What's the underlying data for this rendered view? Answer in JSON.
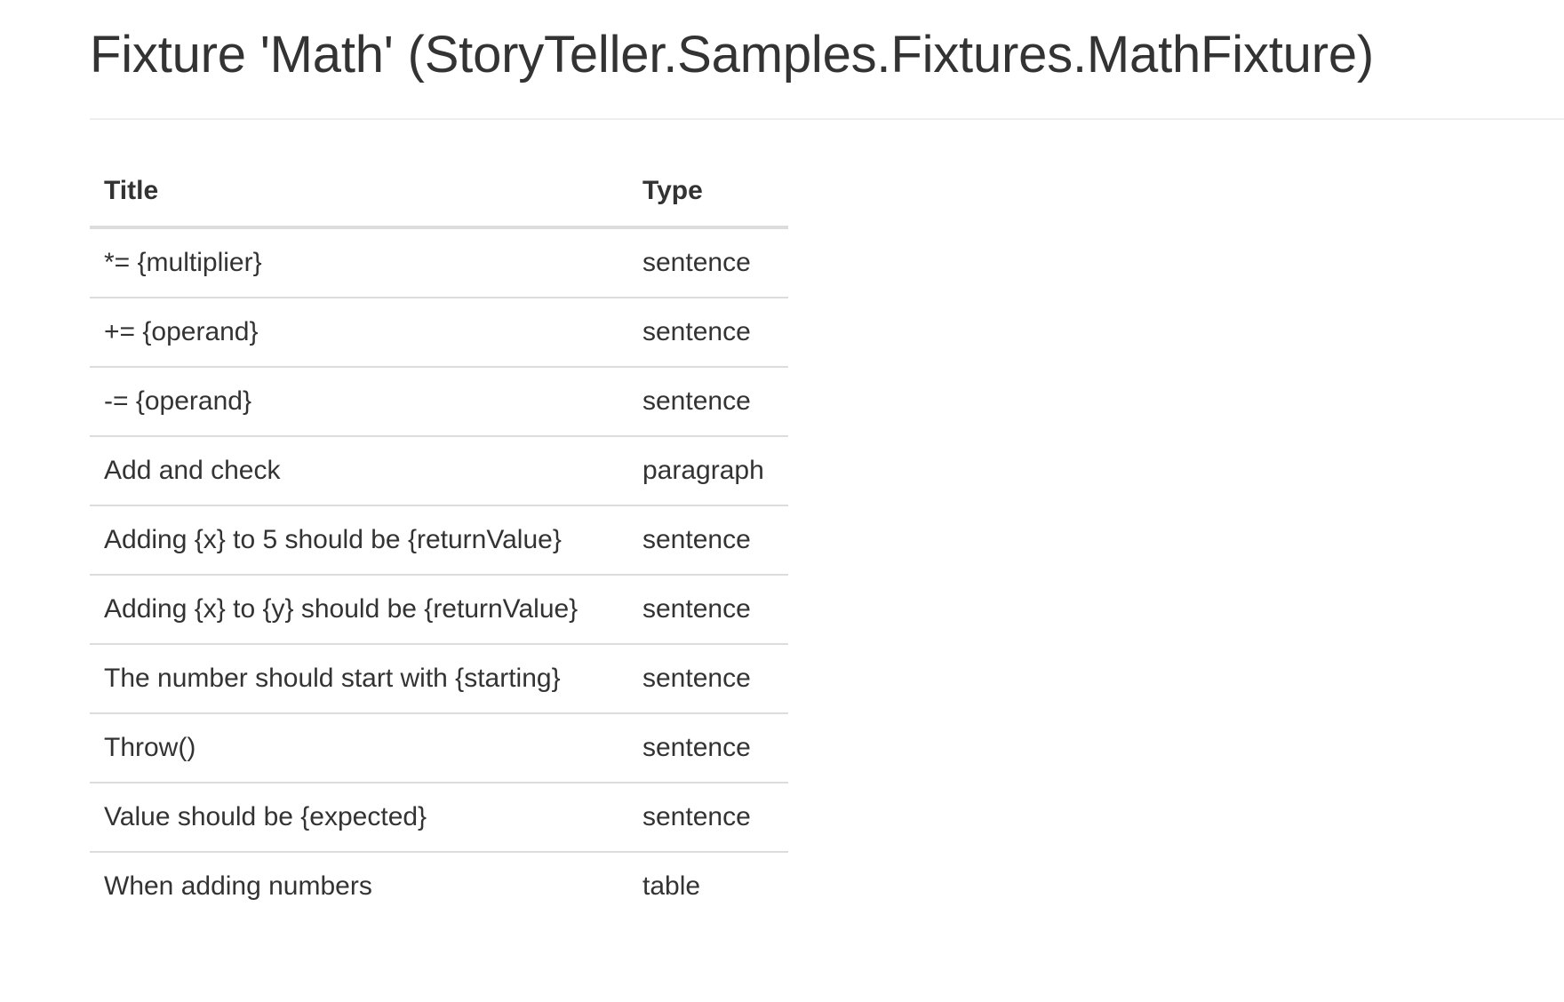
{
  "page": {
    "title": "Fixture 'Math' (StoryTeller.Samples.Fixtures.MathFixture)"
  },
  "table": {
    "headers": {
      "title": "Title",
      "type": "Type"
    },
    "rows": [
      {
        "title": "*= {multiplier}",
        "type": "sentence"
      },
      {
        "title": "+= {operand}",
        "type": "sentence"
      },
      {
        "title": "-= {operand}",
        "type": "sentence"
      },
      {
        "title": "Add and check",
        "type": "paragraph"
      },
      {
        "title": "Adding {x} to 5 should be {returnValue}",
        "type": "sentence"
      },
      {
        "title": "Adding {x} to {y} should be {returnValue}",
        "type": "sentence"
      },
      {
        "title": "The number should start with {starting}",
        "type": "sentence"
      },
      {
        "title": "Throw()",
        "type": "sentence"
      },
      {
        "title": "Value should be {expected}",
        "type": "sentence"
      },
      {
        "title": "When adding numbers",
        "type": "table"
      }
    ]
  }
}
